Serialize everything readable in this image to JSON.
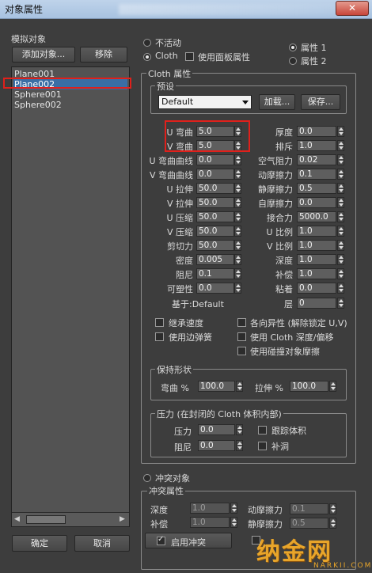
{
  "window": {
    "title": "对象属性",
    "close_label": "✕"
  },
  "sim_objects": {
    "group_title": "模拟对象",
    "add_button": "添加对象...",
    "remove_button": "移除",
    "items": [
      "Plane001",
      "Plane002",
      "Sphere001",
      "Sphere002"
    ],
    "selected_index": 1
  },
  "mode": {
    "inactive_label": "不活动",
    "cloth_label": "Cloth",
    "use_panel_label": "使用面板属性",
    "prop1_label": "属性 1",
    "prop2_label": "属性 2"
  },
  "cloth": {
    "group_title": "Cloth 属性",
    "preset_title": "预设",
    "preset_value": "Default",
    "load_button": "加载...",
    "save_button": "保存...",
    "left_params": [
      {
        "label": "U 弯曲",
        "value": "5.0"
      },
      {
        "label": "V 弯曲",
        "value": "5.0"
      },
      {
        "label": "U 弯曲曲线",
        "value": "0.0"
      },
      {
        "label": "V 弯曲曲线",
        "value": "0.0"
      },
      {
        "label": "U 拉伸",
        "value": "50.0"
      },
      {
        "label": "V 拉伸",
        "value": "50.0"
      },
      {
        "label": "U 压缩",
        "value": "50.0"
      },
      {
        "label": "V 压缩",
        "value": "50.0"
      },
      {
        "label": "剪切力",
        "value": "50.0"
      },
      {
        "label": "密度",
        "value": "0.005"
      },
      {
        "label": "阻尼",
        "value": "0.1"
      },
      {
        "label": "可塑性",
        "value": "0.0"
      }
    ],
    "right_params": [
      {
        "label": "厚度",
        "value": "0.0"
      },
      {
        "label": "排斥",
        "value": "1.0"
      },
      {
        "label": "空气阻力",
        "value": "0.02"
      },
      {
        "label": "动摩擦力",
        "value": "0.1"
      },
      {
        "label": "静摩擦力",
        "value": "0.5"
      },
      {
        "label": "自摩擦力",
        "value": "0.0"
      },
      {
        "label": "接合力",
        "value": "5000.0"
      },
      {
        "label": "U 比例",
        "value": "1.0"
      },
      {
        "label": "V 比例",
        "value": "1.0"
      },
      {
        "label": "深度",
        "value": "1.0"
      },
      {
        "label": "补偿",
        "value": "1.0"
      },
      {
        "label": "粘着",
        "value": "0.0"
      },
      {
        "label": "层",
        "value": "0"
      }
    ],
    "based_on": "基于:Default",
    "options": [
      {
        "label": "继承速度",
        "checked": false
      },
      {
        "label": "各向异性 (解除锁定 U,V)",
        "checked": false
      },
      {
        "label": "使用边弹簧",
        "checked": false
      },
      {
        "label": "使用 Cloth 深度/偏移",
        "checked": false
      },
      {
        "label": "使用碰撞对象摩擦",
        "checked": false
      }
    ]
  },
  "keep_shape": {
    "title": "保持形状",
    "bend_label": "弯曲 %",
    "bend_value": "100.0",
    "stretch_label": "拉伸 %",
    "stretch_value": "100.0"
  },
  "pressure": {
    "title": "压力 (在封闭的 Cloth 体积内部)",
    "pressure_label": "压力",
    "pressure_value": "0.0",
    "damping_label": "阻尼",
    "damping_value": "0.0",
    "track_volume_label": "跟踪体积",
    "cap_holes_label": "补洞"
  },
  "collision": {
    "radio_label": "冲突对象",
    "group_title": "冲突属性",
    "depth_label": "深度",
    "depth_value": "1.0",
    "offset_label": "补偿",
    "offset_value": "1.0",
    "dyn_friction_label": "动摩擦力",
    "dyn_friction_value": "0.1",
    "static_friction_label": "静摩擦力",
    "static_friction_value": "0.5",
    "enable_label": "启用冲突"
  },
  "footer": {
    "ok_button": "确定",
    "cancel_button": "取消"
  },
  "watermark": {
    "text": "纳金网",
    "sub": "NARKII.COM"
  },
  "colors": {
    "highlight_red": "#e0201b",
    "selection_blue": "#3a6ea5",
    "panel_bg": "#3d3d3d"
  }
}
